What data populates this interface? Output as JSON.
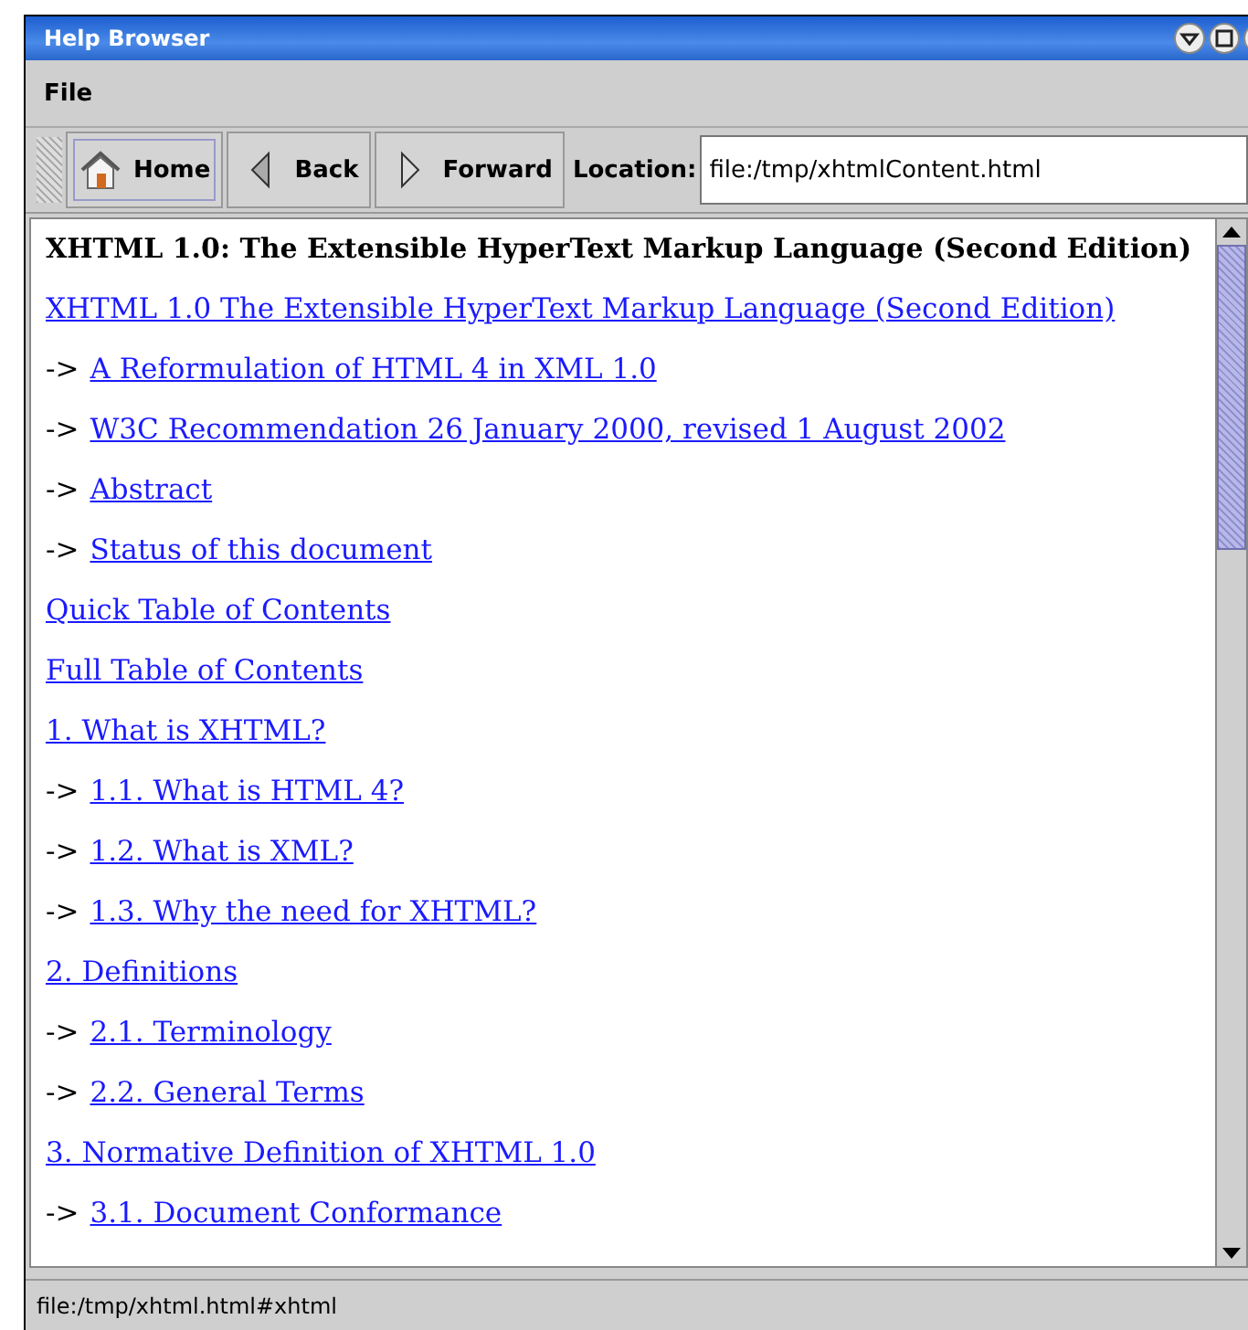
{
  "window": {
    "title": "Help Browser"
  },
  "menu": [
    "File"
  ],
  "toolbar": {
    "buttons": [
      {
        "label": "Home",
        "kind": "home",
        "selected": true
      },
      {
        "label": "Back",
        "kind": "back",
        "selected": false
      },
      {
        "label": "Forward",
        "kind": "forward",
        "selected": false
      }
    ],
    "location_label": "Location:",
    "location": "file:/tmp/xhtmlContent.html"
  },
  "content": {
    "heading": "XHTML 1.0: The Extensible HyperText Markup Language (Second Edition)",
    "lines": [
      {
        "link": "XHTML 1.0 The Extensible HyperText Markup Language (Second Edition)"
      },
      {
        "prefix": "->",
        "link": "A Reformulation of HTML 4 in XML 1.0"
      },
      {
        "prefix": "->",
        "link": "W3C Recommendation 26 January 2000, revised 1 August 2002"
      },
      {
        "prefix": "->",
        "link": "Abstract"
      },
      {
        "prefix": "->",
        "link": "Status of this document"
      },
      {
        "link": "Quick Table of Contents"
      },
      {
        "link": "Full Table of Contents"
      },
      {
        "link": "1. What is XHTML?"
      },
      {
        "prefix": "->",
        "link": "1.1. What is HTML 4?"
      },
      {
        "prefix": "->",
        "link": "1.2. What is XML?"
      },
      {
        "prefix": "->",
        "link": "1.3. Why the need for XHTML?"
      },
      {
        "link": "2. Definitions"
      },
      {
        "prefix": "->",
        "link": "2.1. Terminology"
      },
      {
        "prefix": "->",
        "link": "2.2. General Terms"
      },
      {
        "link": "3. Normative Definition of XHTML 1.0"
      },
      {
        "prefix": "->",
        "link": "3.1. Document Conformance"
      }
    ]
  },
  "status_bar": "file:/tmp/xhtml.html#xhtml"
}
